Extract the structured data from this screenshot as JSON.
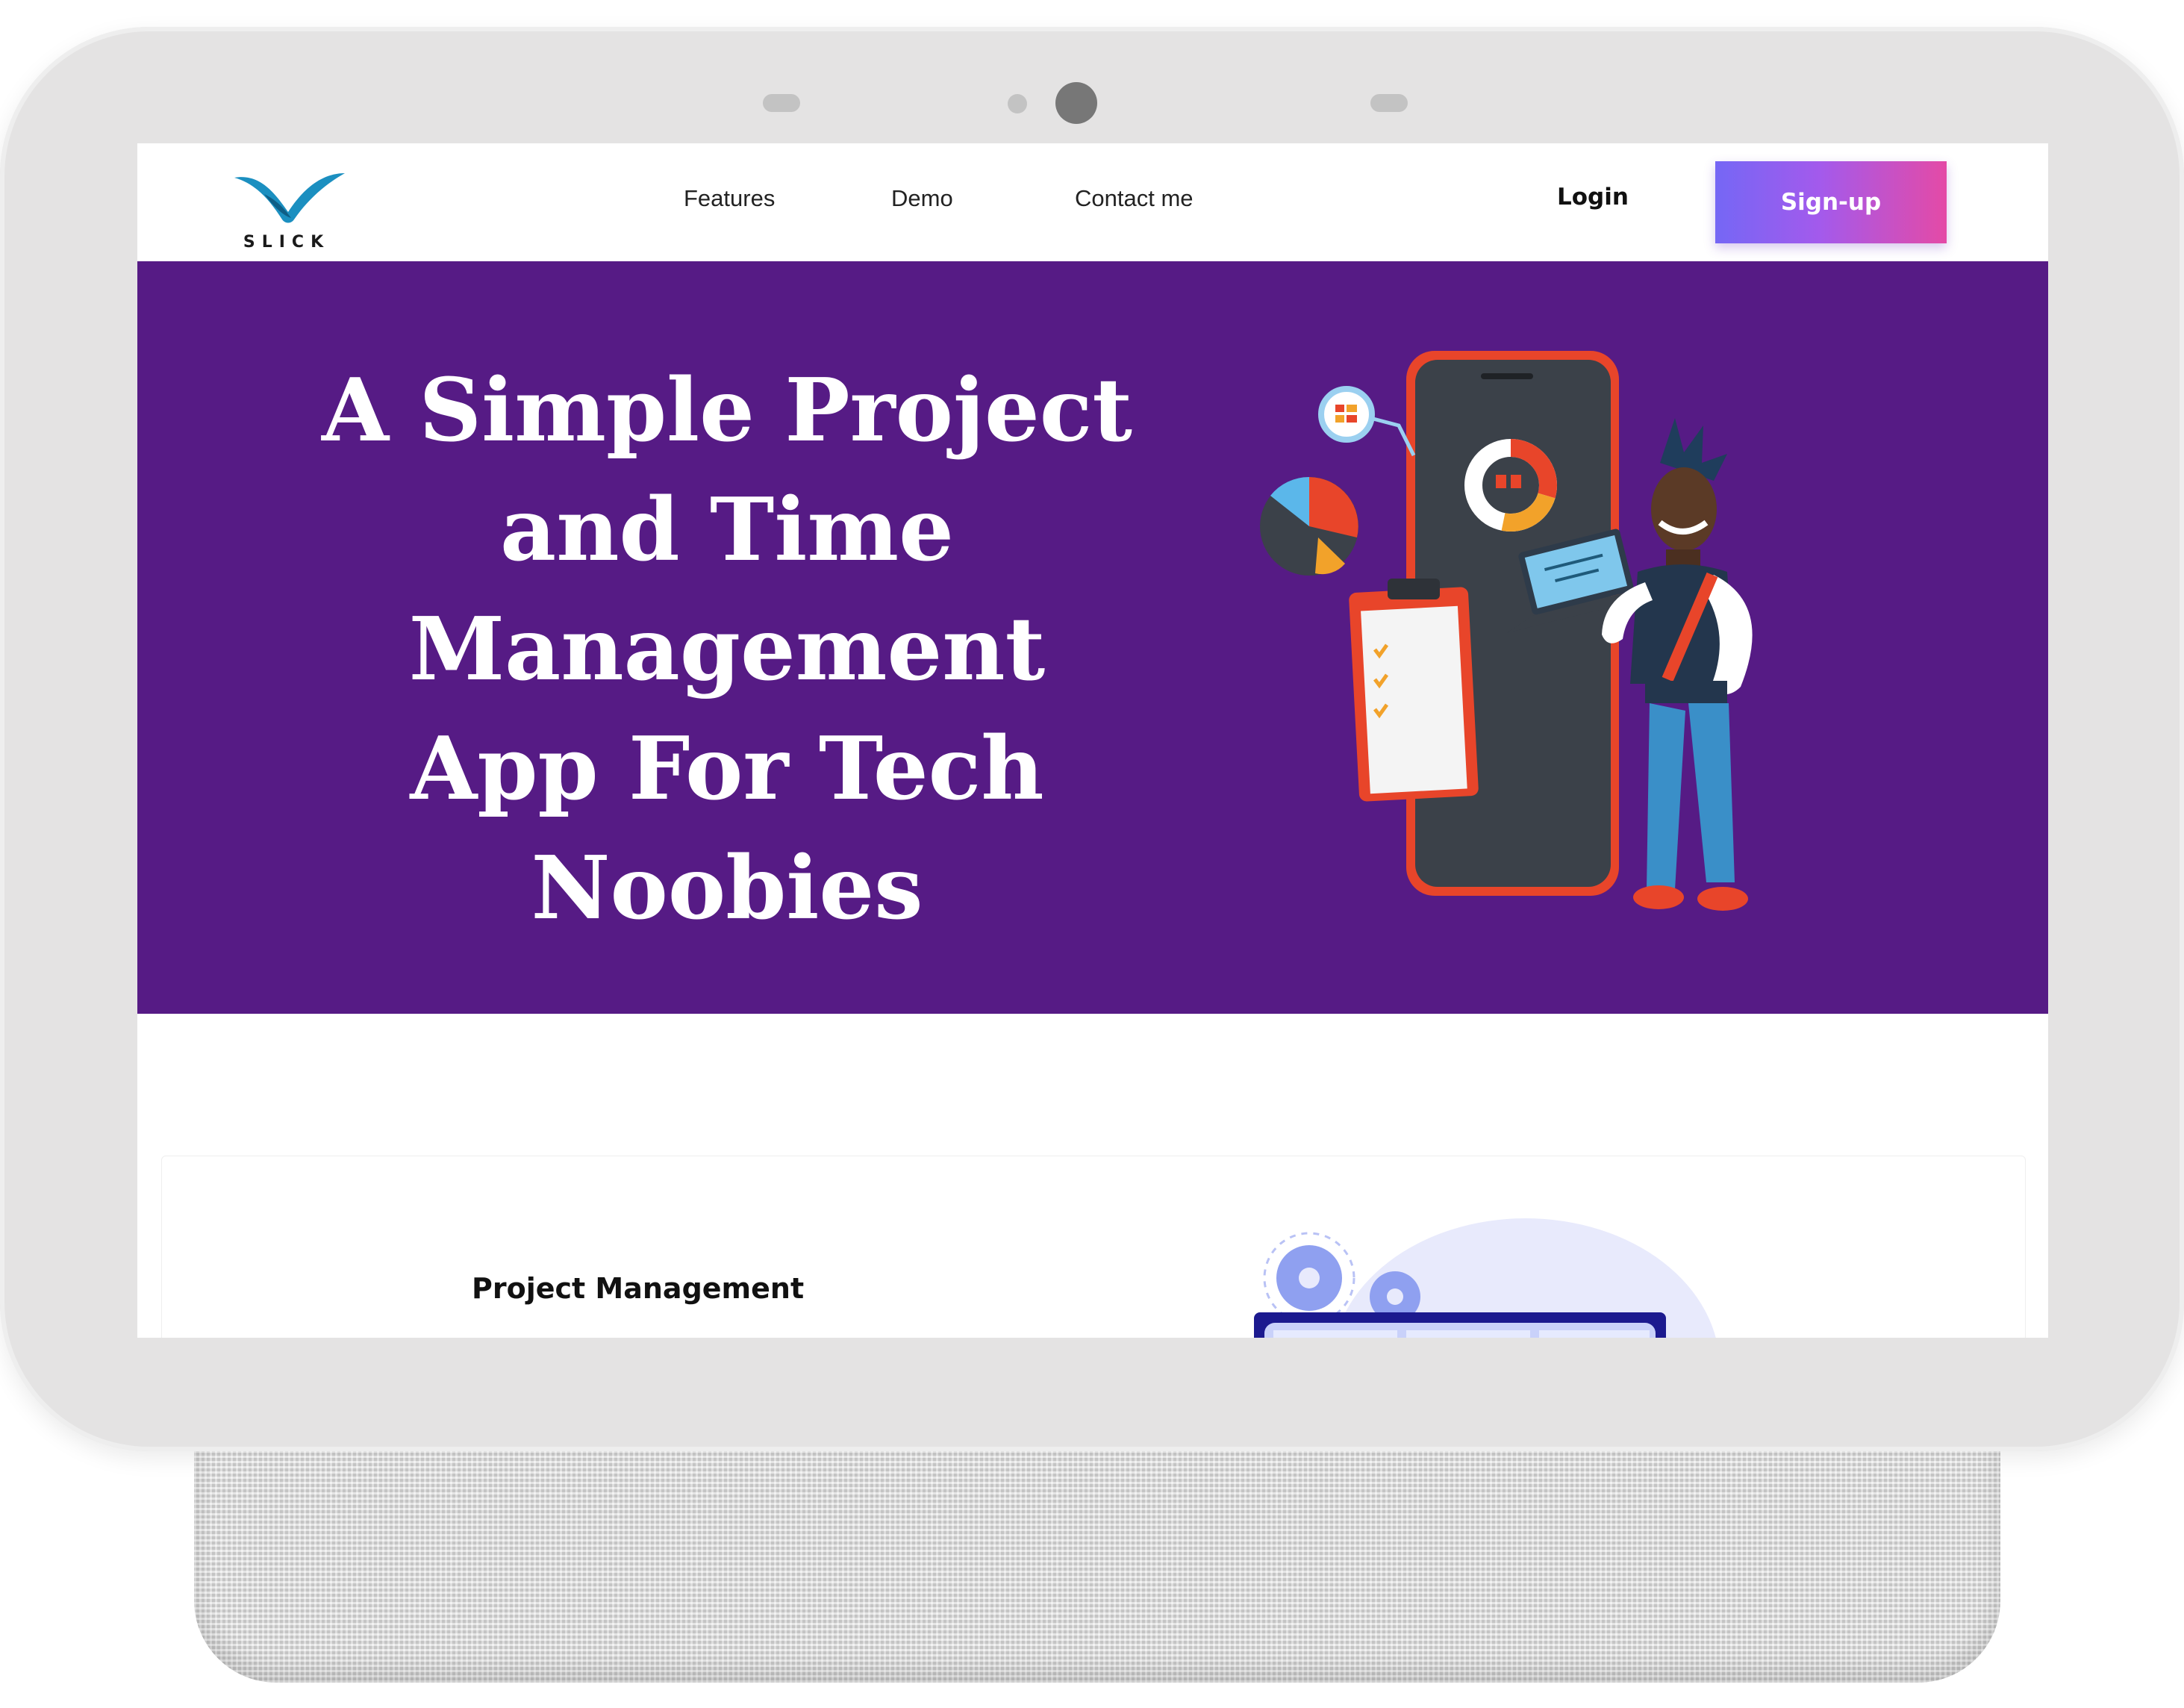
{
  "brand": {
    "name": "SLICK"
  },
  "nav": {
    "links": [
      "Features",
      "Demo",
      "Contact me"
    ],
    "login_label": "Login",
    "signup_label": "Sign-up"
  },
  "hero": {
    "title_lines": [
      "A Simple Project",
      "and Time",
      "Management",
      "App For Tech",
      "Noobies"
    ]
  },
  "features": {
    "first_title": "Project Management"
  },
  "colors": {
    "hero_bg": "#561b85",
    "signup_gradient_start": "#7567f5",
    "signup_gradient_end": "#e44aa6",
    "logo_blue": "#1b8fc0"
  }
}
